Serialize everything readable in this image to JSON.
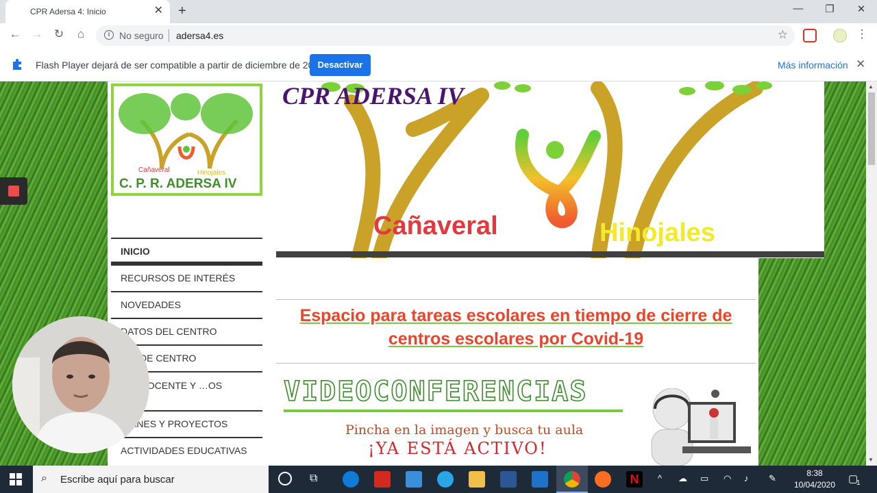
{
  "browser": {
    "tab_title": "CPR Adersa 4: Inicio",
    "omnibox_secure": "No seguro",
    "omnibox_url": "adersa4.es"
  },
  "infobar": {
    "message": "Flash Player dejará de ser compatible a partir de diciembre de 2020.",
    "button": "Desactivar",
    "more": "Más información"
  },
  "logo": {
    "line_main": "C. P. R. ADERSA IV",
    "left_town": "Cañaveral",
    "right_town": "Hinojales"
  },
  "banner": {
    "title": "CPR ADERSA IV",
    "left_town": "Cañaveral",
    "right_town": "Hinojales"
  },
  "menu": {
    "items": [
      {
        "label": "INICIO"
      },
      {
        "label": "RECURSOS DE INTERÉS"
      },
      {
        "label": "NOVEDADES"
      },
      {
        "label": "DATOS DEL CENTRO"
      },
      {
        "label": "…N DE CENTRO"
      },
      {
        "label": "…O DOCENTE Y …OS"
      },
      {
        "label": "…ANES Y PROYECTOS"
      },
      {
        "label": "ACTIVIDADES EDUCATIVAS"
      }
    ]
  },
  "content": {
    "headline": "Espacio para tareas escolares en tiempo de cierre de centros escolares por Covid-19",
    "video_title": "VIDEOCONFERENCIAS",
    "video_sub": "Pincha en la imagen y busca tu aula",
    "video_active": "¡YA ESTÁ ACTIVO!"
  },
  "taskbar": {
    "search_placeholder": "Escribe aquí para buscar",
    "time": "8:38",
    "date": "10/04/2020",
    "notifications": "1"
  },
  "colors": {
    "accent": "#1a73e8",
    "logo_green": "#8cd63b",
    "title_purple": "#4a1470",
    "headline_red": "#e8452c"
  }
}
